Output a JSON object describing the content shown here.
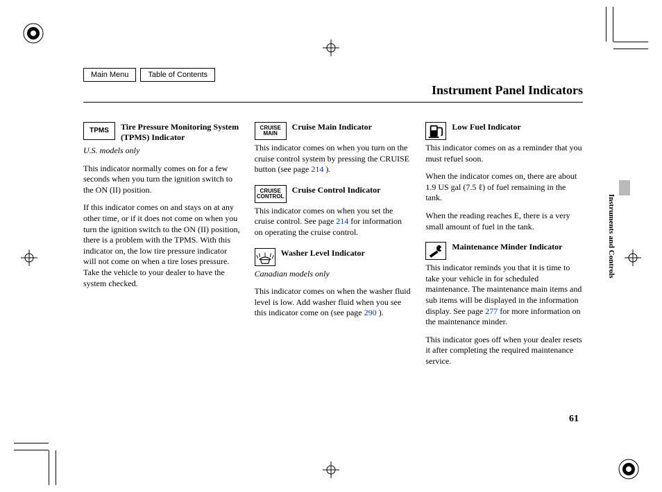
{
  "nav": {
    "main_menu": "Main Menu",
    "toc": "Table of Contents"
  },
  "page_title": "Instrument Panel Indicators",
  "side_label": "Instruments and Controls",
  "page_number": "61",
  "col1": {
    "tpms": {
      "icon_text": "TPMS",
      "title": "Tire Pressure Monitoring System (TPMS) Indicator",
      "note": "U.S. models only",
      "p1": "This indicator normally comes on for a few seconds when you turn the ignition switch to the ON (II) position.",
      "p2": "If this indicator comes on and stays on at any other time, or if it does not come on when you turn the ignition switch to the ON (II) position, there is a problem with the TPMS. With this indicator on, the low tire pressure indicator will not come on when a tire loses pressure. Take the vehicle to your dealer to have the system checked."
    }
  },
  "col2": {
    "cruise_main": {
      "icon_text": "CRUISE MAIN",
      "title": "Cruise Main Indicator",
      "p1a": "This indicator comes on when you turn on the cruise control system by pressing the CRUISE button (see page ",
      "ref": "214",
      "p1b": " )."
    },
    "cruise_control": {
      "icon_text": "CRUISE CONTROL",
      "title": "Cruise Control Indicator",
      "p1a": "This indicator comes on when you set the cruise control. See page ",
      "ref": "214",
      "p1b": " for information on operating the cruise control."
    },
    "washer": {
      "title": "Washer Level Indicator",
      "note": "Canadian models only",
      "p1a": "This indicator comes on when the washer fluid level is low. Add washer fluid when you see this indicator come on (see page ",
      "ref": "290",
      "p1b": " )."
    }
  },
  "col3": {
    "low_fuel": {
      "title": "Low Fuel Indicator",
      "p1": "This indicator comes on as a reminder that you must refuel soon.",
      "p2": "When the indicator comes on, there are about 1.9 US gal (7.5 ℓ) of fuel remaining in the tank.",
      "p3": "When the reading reaches E, there is a very small amount of fuel in the tank."
    },
    "maint": {
      "title": "Maintenance Minder Indicator",
      "p1a": "This indicator reminds you that it is time to take your vehicle in for scheduled maintenance. The maintenance main items and sub items will be displayed in the information display. See page ",
      "ref": "277",
      "p1b": " for more information on the maintenance minder.",
      "p2": "This indicator goes off when your dealer resets it after completing the required maintenance service."
    }
  }
}
